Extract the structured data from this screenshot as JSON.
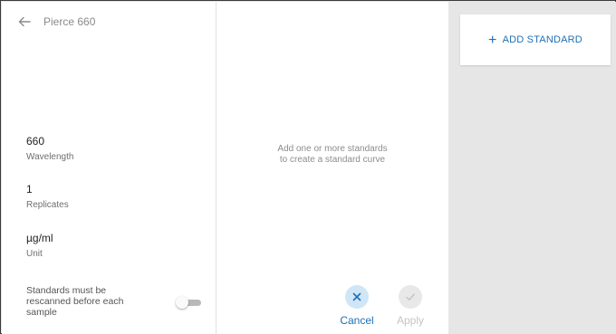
{
  "header": {
    "title": "Pierce 660"
  },
  "settings": {
    "wavelength": {
      "value": "660",
      "label": "Wavelength"
    },
    "replicates": {
      "value": "1",
      "label": "Replicates"
    },
    "unit": {
      "value": "µg/ml",
      "label": "Unit"
    },
    "rescan": {
      "text": "Standards must be rescanned before each sample",
      "enabled": false
    }
  },
  "curve": {
    "empty_line1": "Add one or more standards",
    "empty_line2": "to create a standard curve",
    "cancel_label": "Cancel",
    "apply_label": "Apply"
  },
  "standards": {
    "add_plus": "+",
    "add_label": "ADD STANDARD"
  },
  "colors": {
    "accent": "#1f6fb5",
    "cancel_bg": "#cfe6f6",
    "disabled": "#c4c4c4",
    "panel_bg": "#e6e6e6"
  },
  "icons": {
    "back": "arrow-left-icon",
    "cancel": "close-icon",
    "apply": "check-icon"
  }
}
